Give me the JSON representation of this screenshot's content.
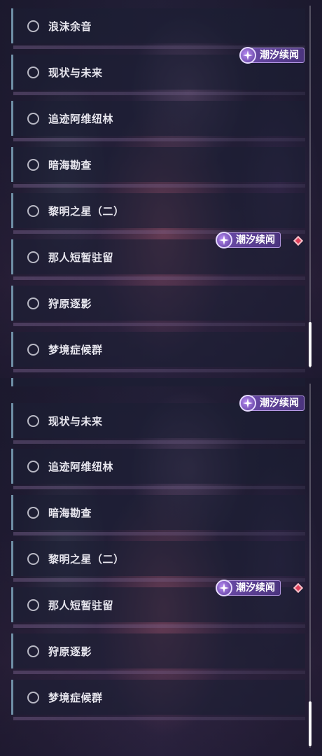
{
  "top_list": {
    "items": [
      {
        "label": "浪沫余音"
      },
      {
        "label": "现状与未来"
      },
      {
        "label": "追迹阿维纽林"
      },
      {
        "label": "暗海勘查"
      },
      {
        "label": "黎明之星（二）"
      },
      {
        "label": "那人短暂驻留"
      },
      {
        "label": "狩原逐影"
      },
      {
        "label": "梦境症候群"
      }
    ],
    "badges": [
      {
        "text": "潮汐续闻"
      },
      {
        "text": "潮汐续闻"
      }
    ]
  },
  "bottom_list": {
    "items": [
      {
        "label": "现状与未来"
      },
      {
        "label": "追迹阿维纽林"
      },
      {
        "label": "暗海勘查"
      },
      {
        "label": "黎明之星（二）"
      },
      {
        "label": "那人短暂驻留"
      },
      {
        "label": "狩原逐影"
      },
      {
        "label": "梦境症候群"
      }
    ],
    "badges": [
      {
        "text": "潮汐续闻"
      },
      {
        "text": "潮汐续闻"
      }
    ]
  },
  "colors": {
    "badge_fill": "#5b3f93",
    "notice_diamond": "#e0405a",
    "item_border": "#6f8fa6"
  },
  "icons": {
    "radio": "radio-unchecked-icon",
    "badge": "sparkle-emblem-icon",
    "notice": "red-diamond-icon"
  }
}
